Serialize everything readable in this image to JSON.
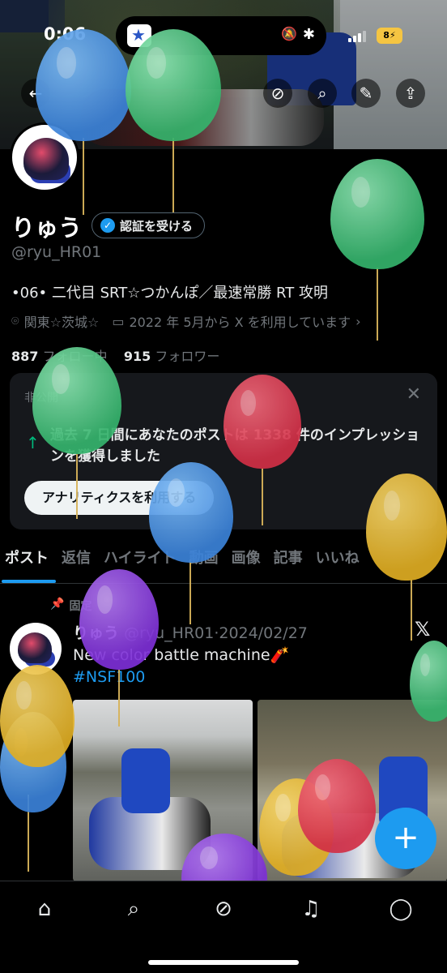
{
  "status_bar": {
    "time": "0:06",
    "battery": "8"
  },
  "profile": {
    "name": "りゅう",
    "verify_label": "認証を受ける",
    "handle": "@ryu_HR01",
    "bio": "•06• 二代目 SRT☆つかんぽ／最速常勝 RT 攻明",
    "location": "関東☆茨城☆",
    "joined": "2022 年 5月から X を利用しています",
    "following_count": "887",
    "following_label": "フォロー中",
    "followers_count": "915",
    "followers_label": "フォロワー"
  },
  "analytics_card": {
    "private_label": "非公開",
    "message": "過去 7 日間にあなたのポストは 1338 件のインプレッションを獲得しました",
    "button_label": "アナリティクスを利用する"
  },
  "tabs": [
    "ポスト",
    "返信",
    "ハイライト",
    "動画",
    "画像",
    "記事",
    "いいね"
  ],
  "active_tab": "ポスト",
  "pinned_post": {
    "pinned_label": "固定",
    "author_name": "りゅう",
    "author_handle": "@ryu_HR01",
    "date": "2024/02/27",
    "text": "New color battle machine🧨",
    "hashtag": "#NSF100"
  },
  "fab_label": "+",
  "icons": {
    "back": "back-arrow-icon",
    "grok": "grok-icon",
    "search": "search-icon",
    "edit": "edit-icon",
    "share": "share-icon",
    "home": "home-icon",
    "explore": "search-icon",
    "grok_nav": "grok-icon",
    "notifications": "bell-icon",
    "messages": "message-icon"
  },
  "colors": {
    "accent": "#1d9bf0",
    "background": "#000000",
    "card": "#16181c",
    "muted": "#71767b"
  }
}
